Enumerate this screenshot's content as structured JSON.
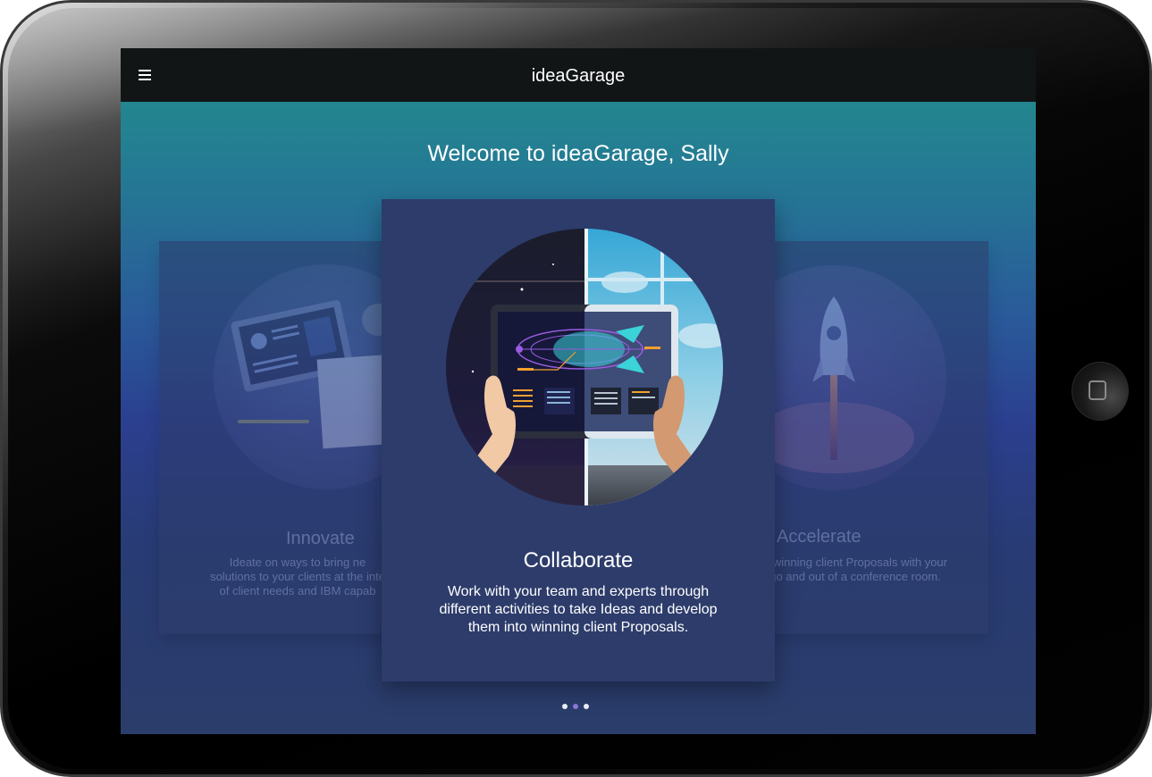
{
  "app": {
    "title": "ideaGarage",
    "welcome": "Welcome to ideaGarage, Sally"
  },
  "carousel": {
    "cards": [
      {
        "title": "Innovate",
        "description_lines": [
          "Ideate on ways to bring ne",
          "solutions to your clients at the inte",
          "of client needs and IBM capab"
        ]
      },
      {
        "title": "Collaborate",
        "description_lines": [
          "Work with your team and experts through",
          "different activities to take Ideas and develop",
          "them into winning client Proposals."
        ]
      },
      {
        "title": "Accelerate",
        "description_lines": [
          "e winning client Proposals with your",
          "go and out of a conference room."
        ]
      }
    ],
    "active_index": 1,
    "page_count": 3
  },
  "colors": {
    "topbar": "#111516",
    "card": "#2d3c6b",
    "dot_inactive": "#e8ecf5",
    "dot_active": "#8a74d6"
  },
  "icons": {
    "menu": "hamburger-menu-icon",
    "home": "home-button-icon"
  }
}
